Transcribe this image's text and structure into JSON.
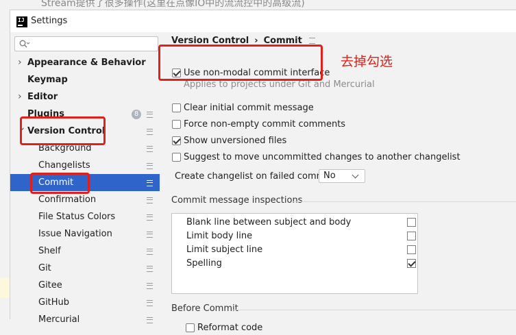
{
  "background_text": "Stream提供了很多操作(这里在点像IO中的流流控中的高级流)",
  "window": {
    "title": "Settings"
  },
  "search": {
    "placeholder": ""
  },
  "sidebar": {
    "items": [
      {
        "label": "Appearance & Behavior",
        "bold": true,
        "arrow": true
      },
      {
        "label": "Keymap",
        "bold": true
      },
      {
        "label": "Editor",
        "bold": true,
        "arrow": true
      },
      {
        "label": "Plugins",
        "bold": true,
        "badge": "8"
      },
      {
        "label": "Version Control",
        "bold": true,
        "arrow": true
      },
      {
        "label": "Background"
      },
      {
        "label": "Changelists"
      },
      {
        "label": "Commit",
        "selected": true
      },
      {
        "label": "Confirmation"
      },
      {
        "label": "File Status Colors"
      },
      {
        "label": "Issue Navigation"
      },
      {
        "label": "Shelf"
      },
      {
        "label": "Git"
      },
      {
        "label": "Gitee"
      },
      {
        "label": "GitHub"
      },
      {
        "label": "Mercurial"
      }
    ]
  },
  "breadcrumb": {
    "parent": "Version Control",
    "separator": "›",
    "current": "Commit"
  },
  "options": {
    "non_modal": {
      "label": "Use non-modal commit interface",
      "checked": true
    },
    "non_modal_hint": "Applies to projects under Git and Mercurial",
    "clear_initial": {
      "label": "Clear initial commit message",
      "checked": false
    },
    "force_non_empty": {
      "label": "Force non-empty commit comments",
      "checked": false
    },
    "show_unversioned": {
      "label": "Show unversioned files",
      "checked": true
    },
    "suggest_move": {
      "label": "Suggest to move uncommitted changes to another changelist",
      "checked": false
    }
  },
  "create_changelist": {
    "label": "Create changelist on failed commit:",
    "value": "No"
  },
  "inspections": {
    "title": "Commit message inspections",
    "rows": [
      {
        "label": "Blank line between subject and body",
        "checked": false
      },
      {
        "label": "Limit body line",
        "checked": false
      },
      {
        "label": "Limit subject line",
        "checked": false
      },
      {
        "label": "Spelling",
        "checked": true
      }
    ]
  },
  "before_commit": {
    "title": "Before Commit",
    "first_option": "Reformat code"
  },
  "annotation": {
    "text": "去掉勾选",
    "color": "#e0201a"
  },
  "colors": {
    "selection": "#2f65ca",
    "highlight": "#e0201a"
  }
}
